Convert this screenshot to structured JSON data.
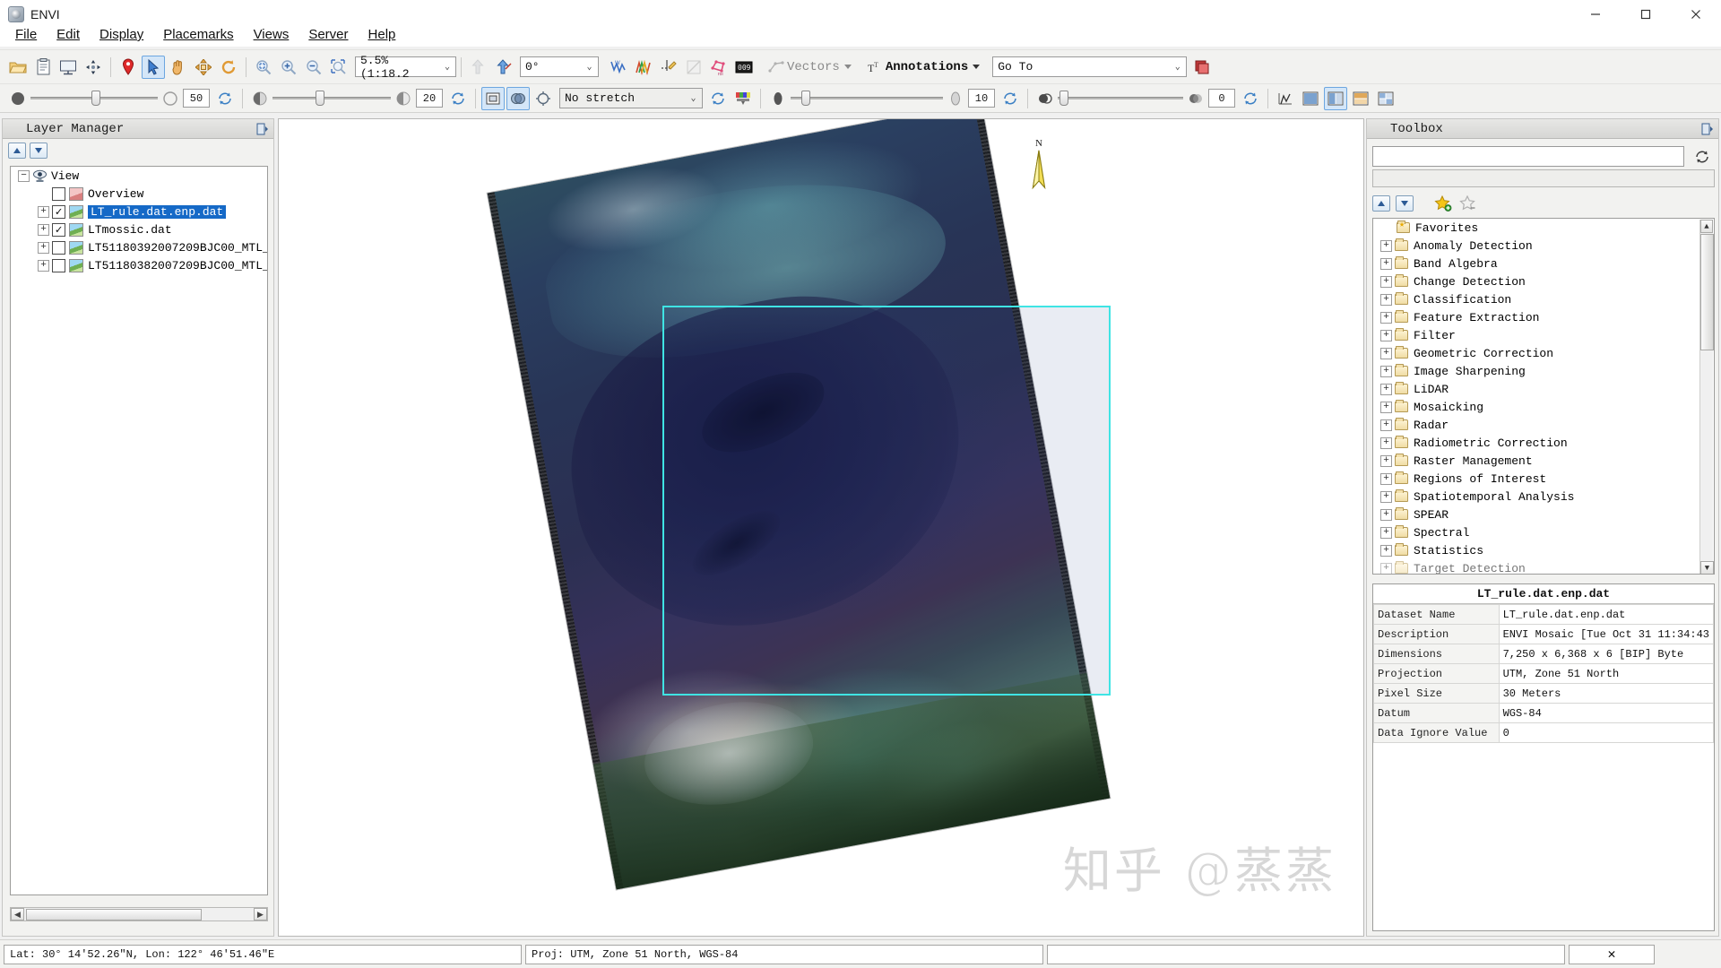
{
  "window": {
    "title": "ENVI",
    "icon": "envi-app-icon",
    "buttons": {
      "minimize": "—",
      "maximize": "❐",
      "close": "✕"
    }
  },
  "menubar": {
    "items": [
      {
        "label": "File",
        "mnemonic": "F"
      },
      {
        "label": "Edit",
        "mnemonic": "E"
      },
      {
        "label": "Display",
        "mnemonic": "D"
      },
      {
        "label": "Placemarks",
        "mnemonic": "P"
      },
      {
        "label": "Views",
        "mnemonic": "V"
      },
      {
        "label": "Server",
        "mnemonic": "S"
      },
      {
        "label": "Help",
        "mnemonic": "H"
      }
    ]
  },
  "toolbar1": {
    "icons": [
      {
        "name": "open-file-icon",
        "title": "Open"
      },
      {
        "name": "clipboard-icon",
        "title": "Open Recent"
      },
      {
        "name": "display-icon",
        "title": "Display"
      },
      {
        "name": "pan-compass-icon",
        "title": "Crosshairs"
      },
      {
        "name": "placemark-pin-icon",
        "title": "Placemark"
      },
      {
        "name": "select-arrow-icon",
        "title": "Select",
        "active": true
      },
      {
        "name": "hand-pan-icon",
        "title": "Pan"
      },
      {
        "name": "move-arrows-icon",
        "title": "Fly"
      },
      {
        "name": "rotate-icon",
        "title": "Rotate"
      },
      {
        "name": "zoom-fit-icon",
        "title": "Zoom To Fit"
      },
      {
        "name": "zoom-in-icon",
        "title": "Zoom In"
      },
      {
        "name": "zoom-out-icon",
        "title": "Zoom Out"
      },
      {
        "name": "zoom-select-icon",
        "title": "Zoom To Selection"
      }
    ],
    "zoom_value": "5.5% (1:18.2",
    "rotation_value": "0°",
    "icons2": [
      {
        "name": "go-to-previous-icon",
        "title": "Previous"
      },
      {
        "name": "go-to-next-icon",
        "title": "Next"
      }
    ],
    "icons3": [
      {
        "name": "cursor-value-icon",
        "title": "Cursor Value"
      },
      {
        "name": "spectral-profile-icon",
        "title": "Spectral Profile"
      },
      {
        "name": "pixel-edit-icon",
        "title": "Edit Pixel"
      },
      {
        "name": "scatter-plot-icon",
        "title": "Scatter Plot"
      },
      {
        "name": "roi-tool-icon",
        "title": "Region of Interest"
      },
      {
        "name": "data-values-icon",
        "title": "Data Values"
      }
    ],
    "vectors_label": "Vectors",
    "annotations_label": "Annotations",
    "goto_value": "Go To",
    "goto_placeholder": "Go To",
    "goto_button": "goto-marker-icon"
  },
  "toolbar2": {
    "transparency_value": "50",
    "brightness_value": "20",
    "stretch_value": "No stretch",
    "contrast_value": "10",
    "sharpen_value": "0",
    "icons": [
      {
        "name": "transparency-icon"
      },
      {
        "name": "reset-transparency-icon"
      },
      {
        "name": "brightness-icon"
      },
      {
        "name": "reset-brightness-icon"
      },
      {
        "name": "portal-icon"
      },
      {
        "name": "blend-icon"
      },
      {
        "name": "flicker-icon"
      },
      {
        "name": "reset-stretch-icon"
      },
      {
        "name": "color-table-icon"
      },
      {
        "name": "contrast-icon"
      },
      {
        "name": "reset-contrast-icon"
      },
      {
        "name": "sharpen-icon"
      },
      {
        "name": "reset-sharpen-icon"
      },
      {
        "name": "histogram-icon"
      },
      {
        "name": "view-single-icon"
      },
      {
        "name": "view-two-vertical-icon"
      },
      {
        "name": "view-two-horizontal-icon"
      },
      {
        "name": "view-four-icon"
      }
    ]
  },
  "layer_manager": {
    "title": "Layer Manager",
    "pin_icon": "panel-pin-icon",
    "up_button": "move-layer-up-icon",
    "down_button": "move-layer-down-icon",
    "tree": [
      {
        "label": "View",
        "depth": 0,
        "expander": "-",
        "checkbox": "none",
        "icon": "view-eye-icon",
        "selected": false
      },
      {
        "label": "Overview",
        "depth": 1,
        "expander": "none",
        "checkbox": "off",
        "icon": "overview-icon",
        "selected": false
      },
      {
        "label": "LT_rule.dat.enp.dat",
        "depth": 1,
        "expander": "+",
        "checkbox": "on",
        "icon": "raster-icon",
        "selected": true
      },
      {
        "label": "LTmossic.dat",
        "depth": 1,
        "expander": "+",
        "checkbox": "on",
        "icon": "raster-icon",
        "selected": false
      },
      {
        "label": "LT51180392007209BJC00_MTL_",
        "depth": 1,
        "expander": "+",
        "checkbox": "off",
        "icon": "raster-icon",
        "selected": false
      },
      {
        "label": "LT51180382007209BJC00_MTL_",
        "depth": 1,
        "expander": "+",
        "checkbox": "off",
        "icon": "raster-icon",
        "selected": false
      }
    ]
  },
  "view": {
    "north_arrow_label": "N",
    "watermark": "知乎 @蒸蒸",
    "roi_box_color": "#3fe4e4"
  },
  "toolbox": {
    "title": "Toolbox",
    "pin_icon": "panel-pin-icon",
    "search_value": "",
    "search_placeholder": "",
    "status_value": "",
    "refresh_icon": "refresh-icon",
    "up_button": "collapse-all-icon",
    "down_button": "expand-all-icon",
    "add_favorite_icon": "add-favorite-star-icon",
    "remove_favorite_icon": "remove-favorite-star-icon",
    "tree": [
      {
        "label": "Favorites",
        "expander": "none",
        "folder": "fav"
      },
      {
        "label": "Anomaly Detection",
        "expander": "+",
        "folder": "plain"
      },
      {
        "label": "Band Algebra",
        "expander": "+",
        "folder": "plain"
      },
      {
        "label": "Change Detection",
        "expander": "+",
        "folder": "plain"
      },
      {
        "label": "Classification",
        "expander": "+",
        "folder": "plain"
      },
      {
        "label": "Feature Extraction",
        "expander": "+",
        "folder": "plain"
      },
      {
        "label": "Filter",
        "expander": "+",
        "folder": "plain"
      },
      {
        "label": "Geometric Correction",
        "expander": "+",
        "folder": "plain"
      },
      {
        "label": "Image Sharpening",
        "expander": "+",
        "folder": "plain"
      },
      {
        "label": "LiDAR",
        "expander": "+",
        "folder": "plain"
      },
      {
        "label": "Mosaicking",
        "expander": "+",
        "folder": "plain"
      },
      {
        "label": "Radar",
        "expander": "+",
        "folder": "plain"
      },
      {
        "label": "Radiometric Correction",
        "expander": "+",
        "folder": "plain"
      },
      {
        "label": "Raster Management",
        "expander": "+",
        "folder": "plain"
      },
      {
        "label": "Regions of Interest",
        "expander": "+",
        "folder": "plain"
      },
      {
        "label": "Spatiotemporal Analysis",
        "expander": "+",
        "folder": "plain"
      },
      {
        "label": "SPEAR",
        "expander": "+",
        "folder": "plain"
      },
      {
        "label": "Spectral",
        "expander": "+",
        "folder": "plain"
      },
      {
        "label": "Statistics",
        "expander": "+",
        "folder": "plain"
      },
      {
        "label": "Target Detection",
        "expander": "+",
        "folder": "plain"
      }
    ]
  },
  "dataset_info": {
    "title": "LT_rule.dat.enp.dat",
    "rows": [
      {
        "key": "Dataset Name",
        "value": "LT_rule.dat.enp.dat"
      },
      {
        "key": "Description",
        "value": "ENVI Mosaic [Tue Oct 31 11:34:43"
      },
      {
        "key": "Dimensions",
        "value": "7,250 x 6,368 x 6 [BIP] Byte"
      },
      {
        "key": "Projection",
        "value": "UTM, Zone 51 North"
      },
      {
        "key": "Pixel Size",
        "value": "30 Meters"
      },
      {
        "key": "Datum",
        "value": "WGS-84"
      },
      {
        "key": "Data Ignore Value",
        "value": "0"
      }
    ]
  },
  "statusbar": {
    "coords": "Lat: 30° 14′52.26″N, Lon: 122° 46′51.46″E",
    "projection": "Proj: UTM, Zone 51 North, WGS-84",
    "blank": "",
    "close_icon": "close-x-icon"
  }
}
